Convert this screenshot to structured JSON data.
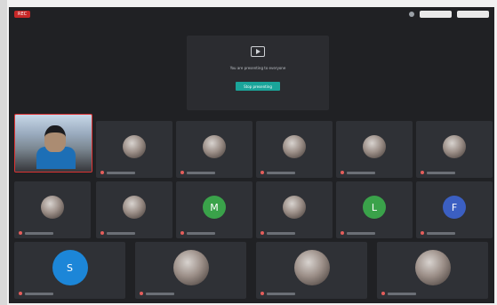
{
  "window": {
    "record_badge": "REC",
    "share_message": "You are presenting to everyone",
    "share_button_label": "Stop presenting"
  },
  "participants": [
    {
      "id": "p1",
      "type": "video"
    },
    {
      "id": "p2",
      "type": "photo"
    },
    {
      "id": "p3",
      "type": "photo"
    },
    {
      "id": "p4",
      "type": "photo"
    },
    {
      "id": "p5",
      "type": "photo"
    },
    {
      "id": "p6",
      "type": "photo"
    },
    {
      "id": "p7",
      "type": "photo"
    },
    {
      "id": "p8",
      "type": "photo"
    },
    {
      "id": "p9",
      "type": "letter",
      "letter": "M",
      "color": "#3aa24a"
    },
    {
      "id": "p10",
      "type": "photo"
    },
    {
      "id": "p11",
      "type": "letter",
      "letter": "L",
      "color": "#3aa24a"
    },
    {
      "id": "p12",
      "type": "letter",
      "letter": "F",
      "color": "#3b5fc2"
    },
    {
      "id": "p13",
      "type": "letter",
      "letter": "S",
      "color": "#1c86d8"
    },
    {
      "id": "p14",
      "type": "photo"
    },
    {
      "id": "p15",
      "type": "photo"
    },
    {
      "id": "p16",
      "type": "photo"
    }
  ]
}
